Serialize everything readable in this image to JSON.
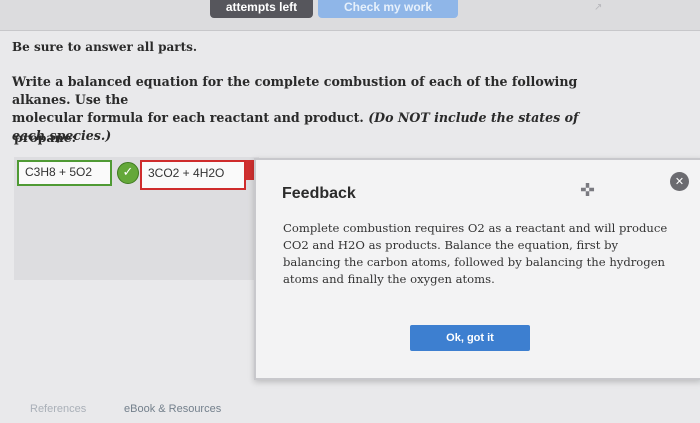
{
  "toolbar": {
    "attempts_label": "attempts left",
    "check_label": "Check my work",
    "corner_mark": "↗"
  },
  "instructions": {
    "answer_all": "Be sure to answer all parts."
  },
  "question": {
    "line1": "Write a balanced equation for the complete combustion of each of the following alkanes. Use the",
    "line2_prefix": "molecular formula for each reactant and product.",
    "line2_italic": "(Do NOT include the states of each species.)"
  },
  "part": {
    "label": "propane:"
  },
  "answer": {
    "reactants": "C3H8 + 5O2",
    "reactant_status": "correct",
    "products": "3CO2 + 4H2O",
    "product_status": "incorrect"
  },
  "feedback": {
    "title": "Feedback",
    "body": "Complete combustion requires O2 as a reactant and will produce CO2 and H2O as products. Balance the equation, first by balancing the carbon atoms, followed by balancing the hydrogen atoms and finally the oxygen atoms.",
    "ok_label": "Ok, got it",
    "close_icon": "✕",
    "drag_icon": "✜"
  },
  "footer": {
    "references_label": "References",
    "ebook_label": "eBook & Resources"
  },
  "colors": {
    "correct": "#64a83a",
    "incorrect": "#cf2c2c",
    "primary_button": "#3d7fd0"
  }
}
